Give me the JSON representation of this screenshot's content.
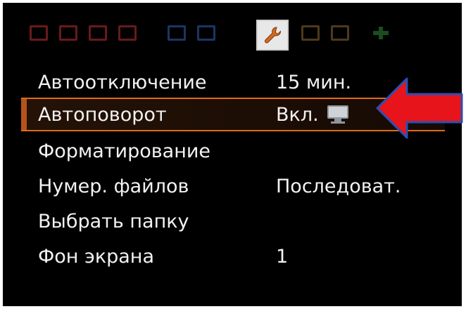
{
  "tabs": [
    {
      "name": "shooting-tab-1",
      "color": "#7a1f22"
    },
    {
      "name": "shooting-tab-2",
      "color": "#7a1f22"
    },
    {
      "name": "shooting-tab-3",
      "color": "#7a1f22"
    },
    {
      "name": "shooting-tab-4",
      "color": "#7a1f22"
    },
    {
      "name": "playback-tab-1",
      "color": "#1f3f73"
    },
    {
      "name": "playback-tab-2",
      "color": "#1f3f73"
    },
    {
      "name": "setup-tab-1",
      "color": "#b3a88a",
      "active": true,
      "icon": "wrench-icon"
    },
    {
      "name": "setup-tab-2",
      "color": "#5a4420"
    },
    {
      "name": "setup-tab-3",
      "color": "#5a4420"
    },
    {
      "name": "mymenu-tab",
      "color": "#1f5a26"
    }
  ],
  "menu": {
    "items": [
      {
        "label": "Автоотключение",
        "value": "15 мин."
      },
      {
        "label": "Автоповорот",
        "value": "Вкл.",
        "value_icon": "monitor-icon",
        "selected": true
      },
      {
        "label": "Форматирование",
        "value": ""
      },
      {
        "label": "Нумер. файлов",
        "value": "Последоват."
      },
      {
        "label": "Выбрать папку",
        "value": ""
      },
      {
        "label": "Фон экрана",
        "value": "1"
      }
    ]
  },
  "colors": {
    "highlight": "#e06a1c",
    "arrow": "#e8141c",
    "arrow_outline": "#2b4fb3",
    "text": "#f2f2f2"
  }
}
